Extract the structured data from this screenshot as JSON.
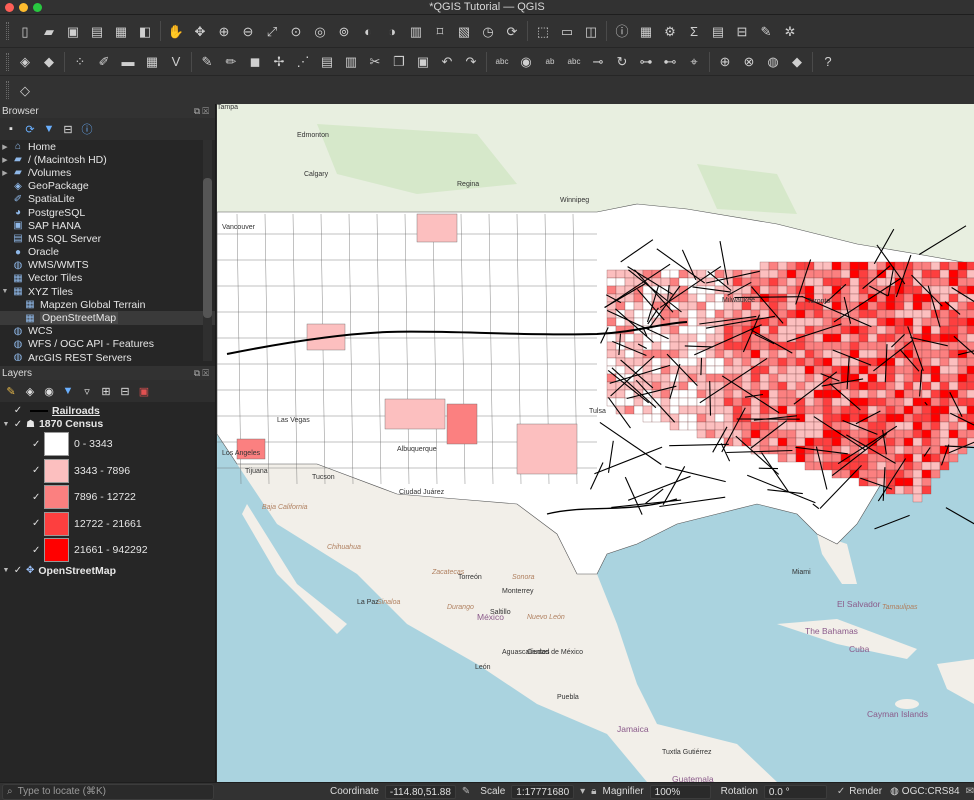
{
  "window": {
    "title": "*QGIS Tutorial — QGIS"
  },
  "toolbar1": {
    "buttons": [
      {
        "name": "new-project-icon",
        "glyph": "▯"
      },
      {
        "name": "open-project-icon",
        "glyph": "▰"
      },
      {
        "name": "save-project-icon",
        "glyph": "▣"
      },
      {
        "name": "new-print-layout-icon",
        "glyph": "▤"
      },
      {
        "name": "layout-manager-icon",
        "glyph": "▦"
      },
      {
        "name": "style-manager-icon",
        "glyph": "◧"
      },
      {
        "name": "pan-map-icon",
        "glyph": "✋"
      },
      {
        "name": "pan-to-selection-icon",
        "glyph": "✥"
      },
      {
        "name": "zoom-in-icon",
        "glyph": "⊕"
      },
      {
        "name": "zoom-out-icon",
        "glyph": "⊖"
      },
      {
        "name": "zoom-full-icon",
        "glyph": "⤢"
      },
      {
        "name": "zoom-to-selection-icon",
        "glyph": "⊙"
      },
      {
        "name": "zoom-to-layer-icon",
        "glyph": "◎"
      },
      {
        "name": "zoom-native-icon",
        "glyph": "⊚"
      },
      {
        "name": "zoom-last-icon",
        "glyph": "◐"
      },
      {
        "name": "zoom-next-icon",
        "glyph": "◑"
      },
      {
        "name": "new-map-view-icon",
        "glyph": "▥"
      },
      {
        "name": "new-bookmark-icon",
        "glyph": "⌑"
      },
      {
        "name": "show-bookmarks-icon",
        "glyph": "▧"
      },
      {
        "name": "temporal-controller-icon",
        "glyph": "◷"
      },
      {
        "name": "refresh-icon",
        "glyph": "⟳"
      },
      {
        "name": "select-features-icon",
        "glyph": "⬚"
      },
      {
        "name": "select-by-value-icon",
        "glyph": "▭"
      },
      {
        "name": "deselect-icon",
        "glyph": "◫"
      },
      {
        "name": "identify-icon",
        "glyph": "ⓘ"
      },
      {
        "name": "attribute-table-icon",
        "glyph": "▦"
      },
      {
        "name": "processing-toolbox-icon",
        "glyph": "⚙"
      },
      {
        "name": "statistical-summary-icon",
        "glyph": "Σ"
      },
      {
        "name": "open-table-icon",
        "glyph": "▤"
      },
      {
        "name": "measure-icon",
        "glyph": "⊟"
      },
      {
        "name": "map-tips-icon",
        "glyph": "✎"
      },
      {
        "name": "settings-icon",
        "glyph": "✲"
      }
    ]
  },
  "toolbar2": {
    "buttons": [
      {
        "name": "data-source-manager-icon",
        "glyph": "◈"
      },
      {
        "name": "new-geopackage-layer-icon",
        "glyph": "◆"
      },
      {
        "name": "new-temp-layer-icon",
        "glyph": "⁘"
      },
      {
        "name": "digitize-icon",
        "glyph": "✐"
      },
      {
        "name": "add-vector-layer-icon",
        "glyph": "▬"
      },
      {
        "name": "add-raster-layer-icon",
        "glyph": "▦"
      },
      {
        "name": "add-mesh-layer-icon",
        "glyph": "V"
      },
      {
        "name": "current-edits-icon",
        "glyph": "✎"
      },
      {
        "name": "toggle-editing-icon",
        "glyph": "✏"
      },
      {
        "name": "save-edits-icon",
        "glyph": "◼"
      },
      {
        "name": "add-feature-icon",
        "glyph": "✢"
      },
      {
        "name": "vertex-tool-icon",
        "glyph": "⋰"
      },
      {
        "name": "modify-attributes-icon",
        "glyph": "▤"
      },
      {
        "name": "delete-selected-icon",
        "glyph": "▥"
      },
      {
        "name": "cut-features-icon",
        "glyph": "✂"
      },
      {
        "name": "copy-features-icon",
        "glyph": "❐"
      },
      {
        "name": "paste-features-icon",
        "glyph": "▣"
      },
      {
        "name": "undo-icon",
        "glyph": "↶"
      },
      {
        "name": "redo-icon",
        "glyph": "↷"
      },
      {
        "name": "label-toolbar-icon",
        "glyph": "abc"
      },
      {
        "name": "label-pin-icon",
        "glyph": "◉"
      },
      {
        "name": "label-highlight-icon",
        "glyph": "ab"
      },
      {
        "name": "label-red-icon",
        "glyph": "abc"
      },
      {
        "name": "move-label-icon",
        "glyph": "⊸"
      },
      {
        "name": "rotate-label-icon",
        "glyph": "↻"
      },
      {
        "name": "change-label-icon",
        "glyph": "⊶"
      },
      {
        "name": "show-hide-labels-icon",
        "glyph": "⊷"
      },
      {
        "name": "pin-labels-icon",
        "glyph": "⌖"
      },
      {
        "name": "add-wms-layer-icon",
        "glyph": "⊕"
      },
      {
        "name": "add-wfs-layer-icon",
        "glyph": "⊗"
      },
      {
        "name": "globe-icon",
        "glyph": "◍"
      },
      {
        "name": "python-console-icon",
        "glyph": "◆"
      },
      {
        "name": "help-icon",
        "glyph": "?"
      }
    ]
  },
  "toolbar3": {
    "buttons": [
      {
        "name": "layer-styling-icon",
        "glyph": "◇"
      }
    ]
  },
  "browser": {
    "title": "Browser",
    "items": [
      {
        "label": "Home",
        "icon": "home-folder-icon",
        "glyph": "⌂",
        "arrow": "▶",
        "child": false
      },
      {
        "label": "/ (Macintosh HD)",
        "icon": "folder-icon",
        "glyph": "▰",
        "arrow": "▶",
        "child": false
      },
      {
        "label": "/Volumes",
        "icon": "folder-icon",
        "glyph": "▰",
        "arrow": "▶",
        "child": false
      },
      {
        "label": "GeoPackage",
        "icon": "geopackage-icon",
        "glyph": "◈",
        "arrow": "",
        "child": false
      },
      {
        "label": "SpatiaLite",
        "icon": "spatialite-icon",
        "glyph": "✐",
        "arrow": "",
        "child": false
      },
      {
        "label": "PostgreSQL",
        "icon": "postgresql-icon",
        "glyph": "◕",
        "arrow": "",
        "child": false
      },
      {
        "label": "SAP HANA",
        "icon": "sap-hana-icon",
        "glyph": "▣",
        "arrow": "",
        "child": false
      },
      {
        "label": "MS SQL Server",
        "icon": "mssql-icon",
        "glyph": "▤",
        "arrow": "",
        "child": false
      },
      {
        "label": "Oracle",
        "icon": "oracle-icon",
        "glyph": "●",
        "arrow": "",
        "child": false
      },
      {
        "label": "WMS/WMTS",
        "icon": "wms-icon",
        "glyph": "◍",
        "arrow": "",
        "child": false
      },
      {
        "label": "Vector Tiles",
        "icon": "vector-tiles-icon",
        "glyph": "▦",
        "arrow": "",
        "child": false
      },
      {
        "label": "XYZ Tiles",
        "icon": "xyz-tiles-icon",
        "glyph": "▦",
        "arrow": "▼",
        "child": false
      },
      {
        "label": "Mapzen Global Terrain",
        "icon": "tile-layer-icon",
        "glyph": "▦",
        "arrow": "",
        "child": true
      },
      {
        "label": "OpenStreetMap",
        "icon": "tile-layer-icon",
        "glyph": "▦",
        "arrow": "",
        "child": true,
        "selected": true
      },
      {
        "label": "WCS",
        "icon": "wcs-icon",
        "glyph": "◍",
        "arrow": "",
        "child": false
      },
      {
        "label": "WFS / OGC API - Features",
        "icon": "wfs-icon",
        "glyph": "◍",
        "arrow": "",
        "child": false
      },
      {
        "label": "ArcGIS REST Servers",
        "icon": "arcgis-icon",
        "glyph": "◍",
        "arrow": "",
        "child": false
      }
    ]
  },
  "layers": {
    "title": "Layers",
    "railroads": {
      "label": "Railroads",
      "check": "✓"
    },
    "census": {
      "label": "1870 Census",
      "arrow": "▼",
      "check": "✓"
    },
    "classes": [
      {
        "label": "0 - 3343",
        "color": "#ffffff"
      },
      {
        "label": "3343 - 7896",
        "color": "#fcbfbf"
      },
      {
        "label": "7896 - 12722",
        "color": "#fb8080"
      },
      {
        "label": "12722 - 21661",
        "color": "#fd3f3f"
      },
      {
        "label": "21661 - 942292",
        "color": "#ff0000"
      }
    ],
    "osm": {
      "label": "OpenStreetMap",
      "arrow": "▼",
      "check": "✓"
    }
  },
  "map": {
    "labels": [
      {
        "text": "Edmonton",
        "cls": "city"
      },
      {
        "text": "Calgary",
        "cls": "city"
      },
      {
        "text": "Regina",
        "cls": "city"
      },
      {
        "text": "Winnipeg",
        "cls": "city"
      },
      {
        "text": "Vancouver",
        "cls": "city"
      },
      {
        "text": "Las Vegas",
        "cls": "city"
      },
      {
        "text": "Los Angeles",
        "cls": "city"
      },
      {
        "text": "Tijuana",
        "cls": "city"
      },
      {
        "text": "Tucson",
        "cls": "city"
      },
      {
        "text": "Albuquerque",
        "cls": "city"
      },
      {
        "text": "Tulsa",
        "cls": "city"
      },
      {
        "text": "Ciudad Juárez",
        "cls": "city"
      },
      {
        "text": "Milwaukee",
        "cls": "city"
      },
      {
        "text": "Toronto",
        "cls": "city"
      },
      {
        "text": "Torreón",
        "cls": "city"
      },
      {
        "text": "Monterrey",
        "cls": "city"
      },
      {
        "text": "Saltillo",
        "cls": "city"
      },
      {
        "text": "México",
        "cls": "country"
      },
      {
        "text": "Aguascalientes",
        "cls": "city"
      },
      {
        "text": "León",
        "cls": "city"
      },
      {
        "text": "Ciudad de México",
        "cls": "city"
      },
      {
        "text": "Puebla",
        "cls": "city"
      },
      {
        "text": "La Paz",
        "cls": "city"
      },
      {
        "text": "Baja California",
        "cls": "state"
      },
      {
        "text": "Sinaloa",
        "cls": "state"
      },
      {
        "text": "Durango",
        "cls": "state"
      },
      {
        "text": "Zacatecas",
        "cls": "state"
      },
      {
        "text": "Chihuahua",
        "cls": "state"
      },
      {
        "text": "Sonora",
        "cls": "state"
      },
      {
        "text": "Nuevo León",
        "cls": "state"
      },
      {
        "text": "Tamaulipas",
        "cls": "state"
      },
      {
        "text": "The Bahamas",
        "cls": "country"
      },
      {
        "text": "Cuba",
        "cls": "country"
      },
      {
        "text": "Cayman Islands",
        "cls": "country"
      },
      {
        "text": "Jamaica",
        "cls": "country"
      },
      {
        "text": "Tuxtla Gutiérrez",
        "cls": "city"
      },
      {
        "text": "Guatemala",
        "cls": "country"
      },
      {
        "text": "El Salvador",
        "cls": "country"
      },
      {
        "text": "Miami",
        "cls": "city"
      },
      {
        "text": "Tampa",
        "cls": "city"
      }
    ]
  },
  "status": {
    "locate_placeholder": "Type to locate (⌘K)",
    "coordinate_label": "Coordinate",
    "coordinate_value": "-114.80,51.88",
    "scale_label": "Scale",
    "scale_value": "1:17771680",
    "magnifier_label": "Magnifier",
    "magnifier_value": "100%",
    "rotation_label": "Rotation",
    "rotation_value": "0.0 °",
    "render_check": "✓",
    "render_label": "Render",
    "crs_value": "OGC:CRS84"
  },
  "colors": {
    "ocean": "#aad3df",
    "land_canada": "#e8efe0",
    "land": "#f2efe9",
    "choropleth_low": "#ffffff",
    "choropleth_high": "#ff0000",
    "railroad": "#000000"
  }
}
